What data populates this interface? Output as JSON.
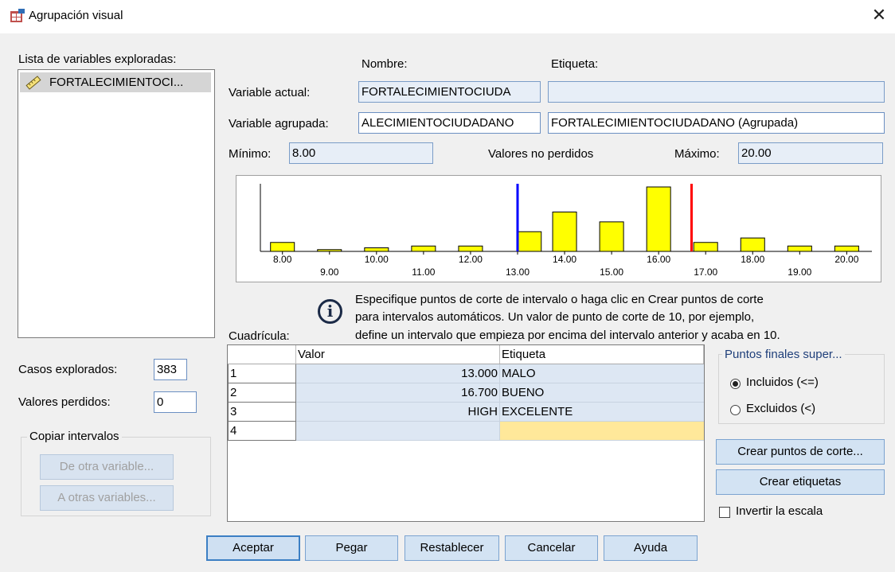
{
  "window": {
    "title": "Agrupación visual",
    "close_glyph": "✕"
  },
  "left": {
    "list_title": "Lista de variables exploradas:",
    "list_item": "FORTALECIMIENTOCI...",
    "list_item_icon": "ruler-icon",
    "cases_label": "Casos explorados:",
    "cases_value": "383",
    "missing_label": "Valores perdidos:",
    "missing_value": "0",
    "copy_group": "Copiar intervalos",
    "copy_from": "De otra variable...",
    "copy_to": "A otras variables..."
  },
  "header": {
    "name_col": "Nombre:",
    "label_col": "Etiqueta:"
  },
  "current_var": {
    "label": "Variable actual:",
    "name": "FORTALECIMIENTOCIUDA",
    "etiqueta": ""
  },
  "binned_var": {
    "label": "Variable agrupada:",
    "name": "ALECIMIENTOCIUDADANO",
    "etiqueta": "FORTALECIMIENTOCIUDADANO (Agrupada)"
  },
  "stats": {
    "min_label": "Mínimo:",
    "min_value": "8.00",
    "nonmissing_label": "Valores no perdidos",
    "max_label": "Máximo:",
    "max_value": "20.00"
  },
  "chart_data": {
    "type": "bar",
    "x": [
      8,
      9,
      10,
      11,
      12,
      13.25,
      14,
      15,
      16,
      17,
      18,
      19,
      20
    ],
    "values": [
      10,
      2,
      4,
      6,
      6,
      22,
      44,
      33,
      72,
      10,
      15,
      6,
      6
    ],
    "xlim": [
      7.7,
      20.4
    ],
    "tick_labels_upper": [
      "8.00",
      "10.00",
      "12.00",
      "14.00",
      "16.00",
      "18.00",
      "20.00"
    ],
    "tick_labels_lower": [
      "9.00",
      "11.00",
      "13.00",
      "15.00",
      "17.00",
      "19.00"
    ],
    "cutpoints": [
      {
        "value": 13.0,
        "color": "#0000ff"
      },
      {
        "value": 16.7,
        "color": "#ff0000"
      }
    ],
    "bar_color": "#ffff00"
  },
  "info": {
    "icon": "info-icon",
    "line1": "Especifique puntos de corte de intervalo o haga clic en Crear puntos de corte",
    "line2": "para intervalos automáticos. Un valor de punto de corte de 10, por ejemplo,",
    "line3": "define un intervalo que empieza por encima del intervalo anterior y acaba en 10."
  },
  "grid": {
    "title": "Cuadrícula:",
    "col_value": "Valor",
    "col_label": "Etiqueta",
    "rows": [
      {
        "n": "1",
        "value": "13.000",
        "label": "MALO"
      },
      {
        "n": "2",
        "value": "16.700",
        "label": "BUENO"
      },
      {
        "n": "3",
        "value": "HIGH",
        "label": "EXCELENTE"
      },
      {
        "n": "4",
        "value": "",
        "label": ""
      }
    ]
  },
  "endpoints": {
    "title": "Puntos finales super...",
    "included": "Incluidos (<=)",
    "excluded": "Excluidos (<)",
    "selected": "included"
  },
  "right_buttons": {
    "make_cutpoints": "Crear puntos de corte...",
    "make_labels": "Crear etiquetas",
    "reverse_scale": "Invertir la escala"
  },
  "bottom": {
    "ok": "Aceptar",
    "paste": "Pegar",
    "reset": "Restablecer",
    "cancel": "Cancelar",
    "help": "Ayuda"
  }
}
